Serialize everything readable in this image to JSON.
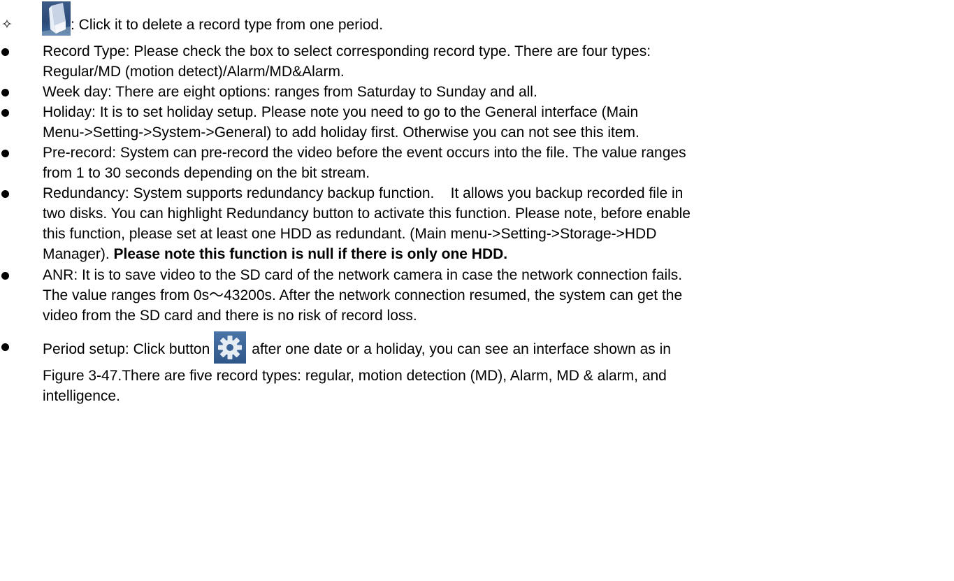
{
  "items": [
    {
      "marker": "✧",
      "lines": [
        ": Click it to delete a record type from one period."
      ]
    },
    {
      "marker": "dot",
      "lines": [
        "Record Type: Please check the box to select corresponding record type. There are four types:",
        "Regular/MD (motion detect)/Alarm/MD&Alarm."
      ]
    },
    {
      "marker": "dot",
      "lines": [
        "Week day: There are eight options: ranges from Saturday to Sunday and all."
      ]
    },
    {
      "marker": "dot",
      "lines": [
        "Holiday: It is to set holiday setup. Please note you need to go to the General interface (Main",
        "Menu->Setting->System->General) to add holiday first. Otherwise you can not see this item."
      ]
    },
    {
      "marker": "dot",
      "lines": [
        "Pre-record: System can pre-record the video before the event occurs into the file. The value ranges",
        "from 1 to 30 seconds depending on the bit stream."
      ]
    },
    {
      "marker": "dot",
      "lines": [
        "Redundancy: System supports redundancy backup function.    It allows you backup recorded file in",
        "two disks. You can highlight Redundancy button to activate this function. Please note, before enable",
        "this function, please set at least one HDD as redundant. (Main menu->Setting->Storage->HDD",
        "Manager). "
      ],
      "bold_tail": "Please note this function is null if there is only one HDD."
    },
    {
      "marker": "dot",
      "lines": [
        "ANR: It is to save video to the SD card of the network camera in case the network connection fails.",
        "The value ranges from 0s～43200s. After the network connection resumed, the system can get the",
        "video from the SD card and there is no risk of record loss."
      ]
    },
    {
      "marker": "dot",
      "lead": "Period setup: Click button",
      "after_icon": "after one date or a holiday, you can see an interface shown as in",
      "lines": [
        "Figure 3-47.There are five record types: regular, motion detection (MD), Alarm, MD & alarm, and",
        "intelligence."
      ]
    }
  ],
  "icons": {
    "eraser": "eraser-icon",
    "gear": "gear-icon"
  },
  "colors": {
    "icon_blue": "#2b4a78",
    "text": "#000000",
    "background": "#ffffff"
  }
}
